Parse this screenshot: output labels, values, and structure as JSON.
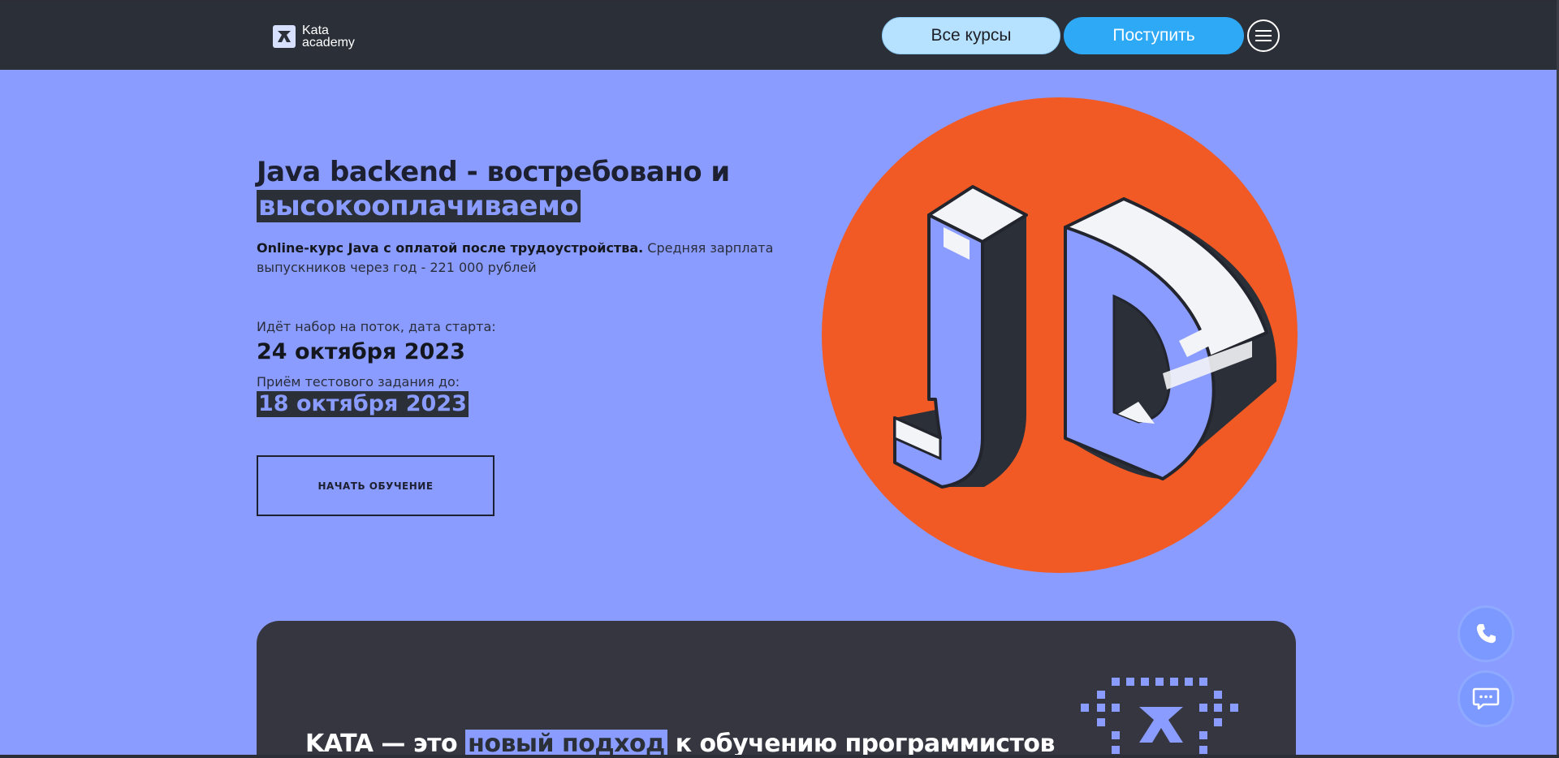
{
  "header": {
    "logo_line1": "Kata",
    "logo_line2": "academy",
    "courses_label": "Все курсы",
    "apply_label": "Поступить",
    "menu_icon": "hamburger-menu-icon"
  },
  "hero": {
    "title_line1": "Java backend - востребовано и",
    "title_line2": "высокооплачиваемо",
    "subtitle_bold": "Online-курс Java с оплатой после трудоустройства.",
    "subtitle_rest": " Средняя зарплата выпускников через год - 221 000 рублей",
    "start_label": "Идёт набор на поток, дата старта:",
    "start_date": "24 октября 2023",
    "test_label": "Приём тестового задания до:",
    "test_date": "18 октября 2023",
    "cta_label": "НАЧАТЬ ОБУЧЕНИЕ"
  },
  "illustration": {
    "letters_icon": "jd-letters-icon",
    "circle_color": "#f15a24",
    "letter_color": "#8a9cff"
  },
  "kata": {
    "title_part1": "KATA — это ",
    "title_highlight": "новый подход",
    "title_part2": " к обучению программистов"
  },
  "floating": {
    "phone_icon": "phone-icon",
    "chat_icon": "chat-icon"
  },
  "colors": {
    "background": "#8a9cff",
    "header": "#2b2f38",
    "accent_blue": "#2ea9f5",
    "light_blue": "#b7e2ff",
    "dark_section": "#363640"
  }
}
